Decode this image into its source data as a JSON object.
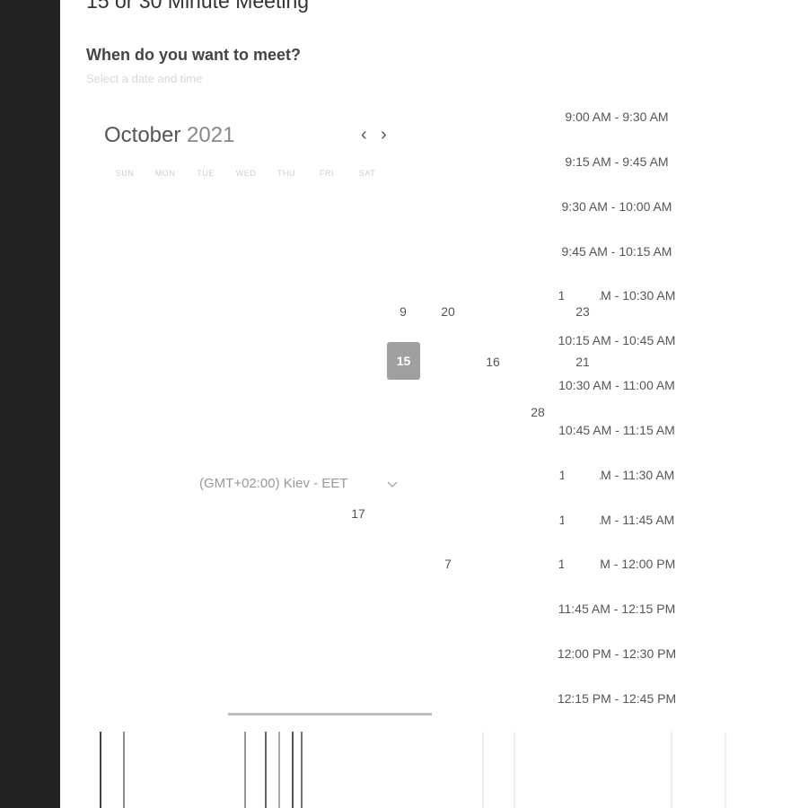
{
  "page": {
    "title": "15 or 30 Minute Meeting",
    "question": "When do you want to meet?",
    "subtitle": "Select a date and time"
  },
  "calendar": {
    "month": "October",
    "year": "2021",
    "weekdays": [
      "SUN",
      "MON",
      "TUE",
      "WED",
      "THU",
      "FRI",
      "SAT"
    ],
    "days": {
      "d9": "9",
      "d20": "20",
      "d23": "23",
      "selected": "15",
      "d16": "16",
      "d21": "21",
      "d28": "28",
      "d17": "17",
      "d7": "7"
    }
  },
  "timezone": {
    "label": "(GMT+02:00) Kiev - EET"
  },
  "time_slots": [
    "9:00 AM - 9:30 AM",
    "9:15 AM - 9:45 AM",
    "9:30 AM - 10:00 AM",
    "9:45 AM - 10:15 AM",
    "10:00 AM - 10:30 AM",
    "10:15 AM - 10:45 AM",
    "10:30 AM - 11:00 AM",
    "10:45 AM - 11:15 AM",
    "11:00 AM - 11:30 AM",
    "11:15 AM - 11:45 AM",
    "11:30 AM - 12:00 PM",
    "11:45 AM - 12:15 PM",
    "12:00 PM - 12:30 PM",
    "12:15 PM - 12:45 PM"
  ]
}
